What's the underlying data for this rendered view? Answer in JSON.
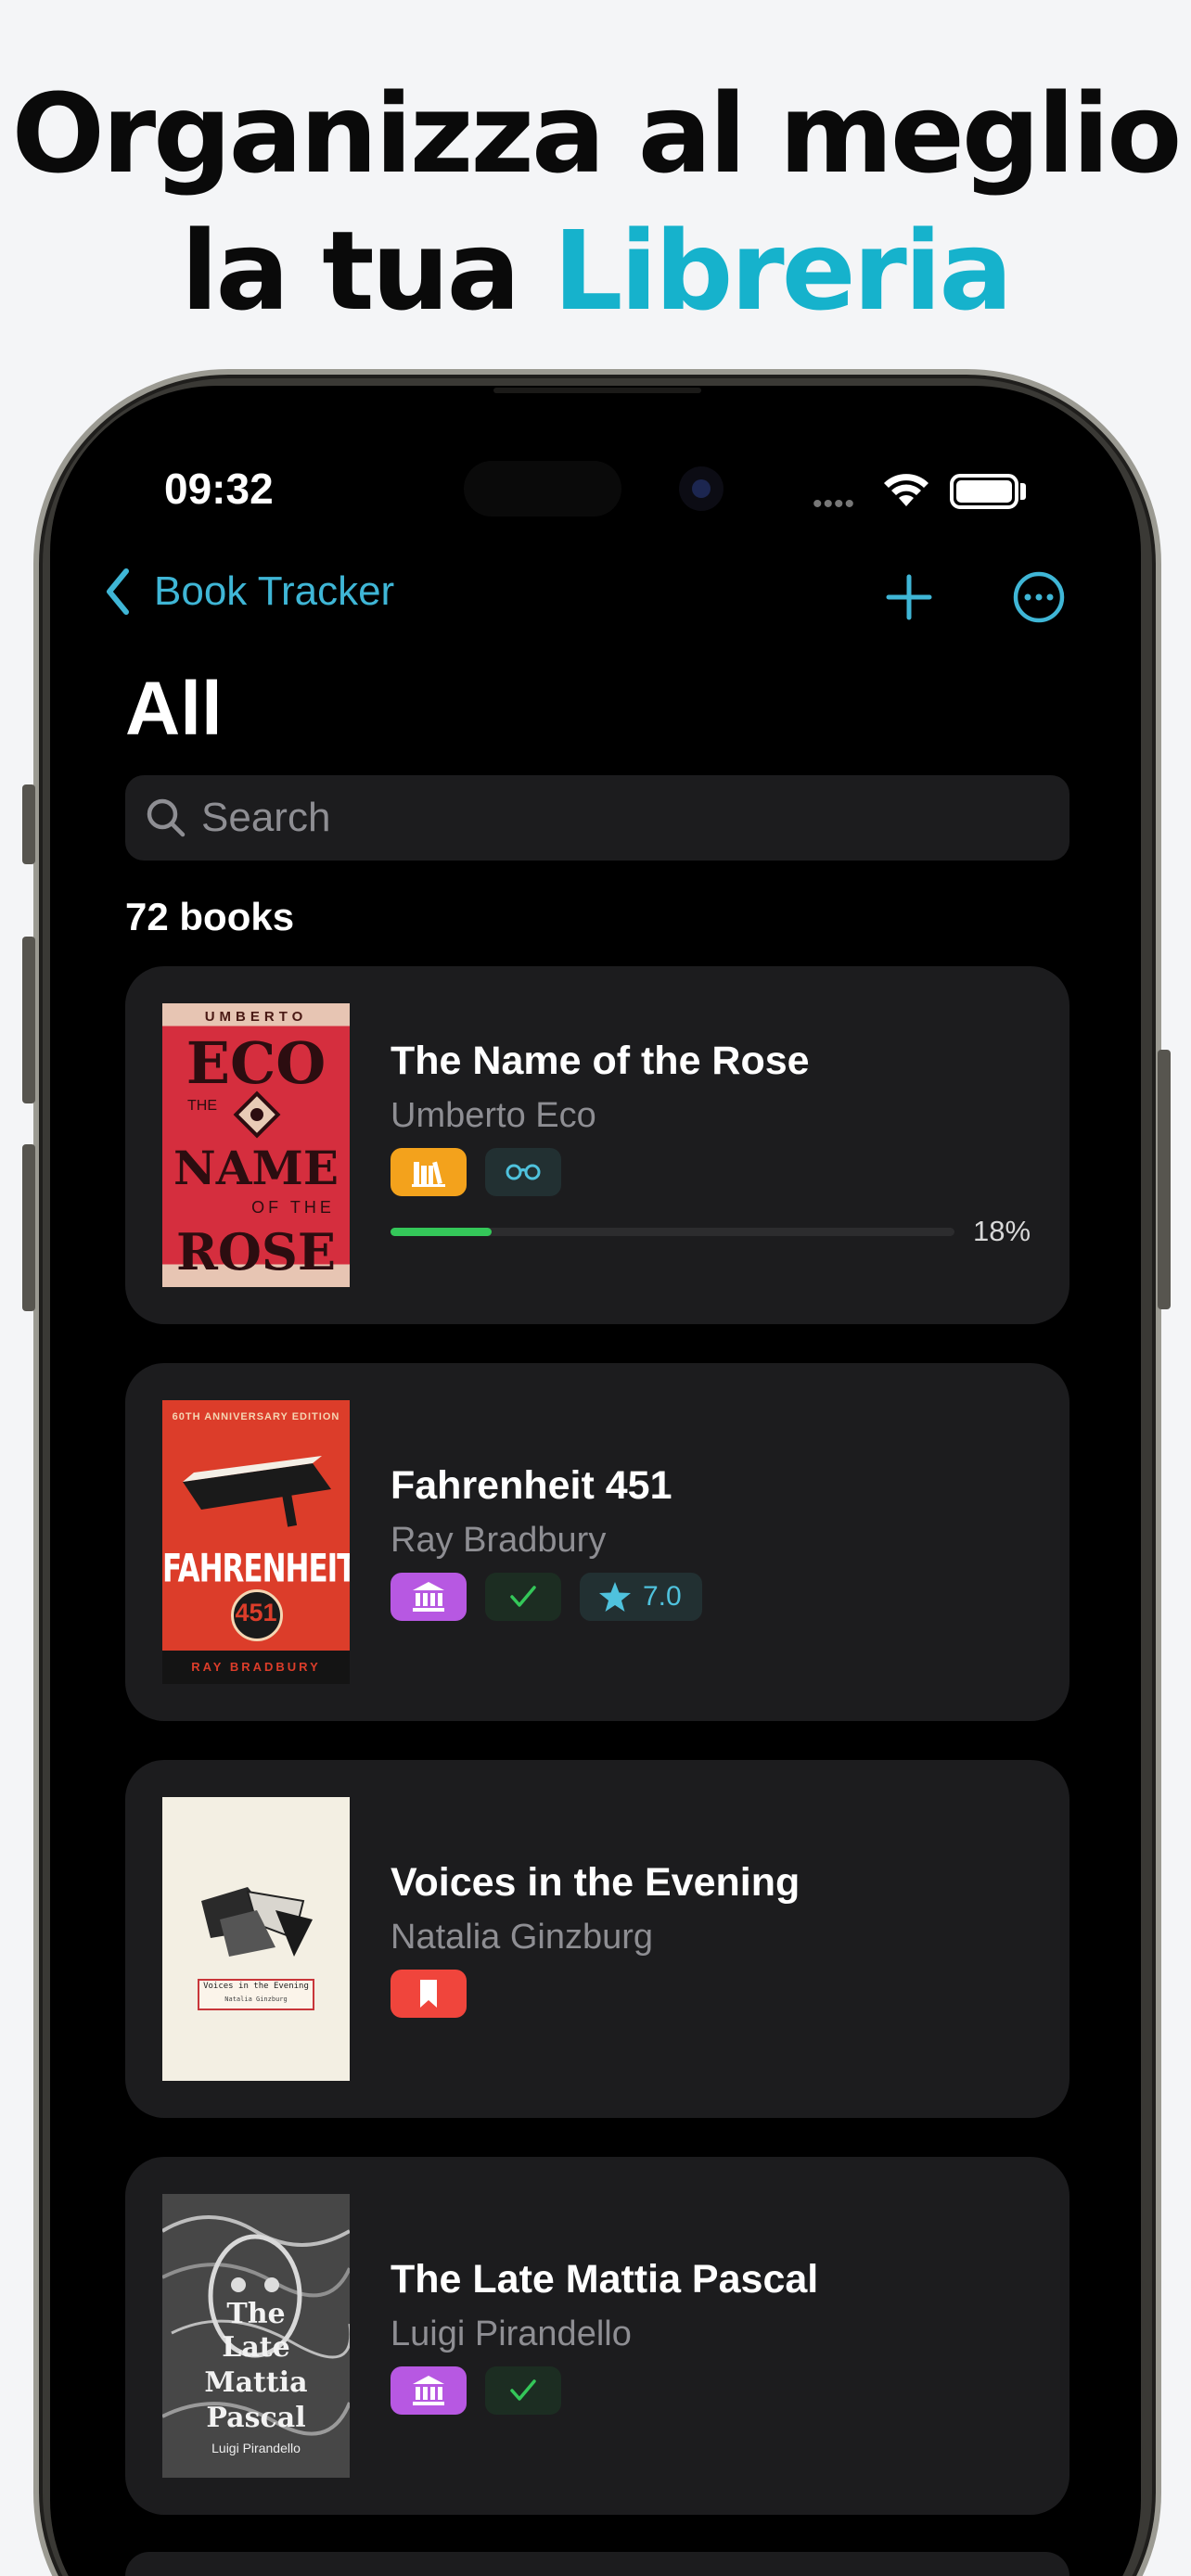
{
  "headline": {
    "line1": "Organizza al meglio",
    "line2_plain": "la tua",
    "line2_accent": "Libreria"
  },
  "colors": {
    "accent": "#16b2cc",
    "tint": "#3fb6d6",
    "progress": "#34c759",
    "shelf_orange": "#f3a21c",
    "shelf_purple": "#b758e2",
    "shelf_red": "#f0453c",
    "card": "#1c1c1e"
  },
  "status_bar": {
    "time": "09:32"
  },
  "nav": {
    "back_label": "Book Tracker",
    "back_icon": "chevron-left-icon",
    "add_icon": "plus-icon",
    "more_icon": "ellipsis-circle-icon"
  },
  "page": {
    "title": "All",
    "search_placeholder": "Search",
    "count_label": "72 books"
  },
  "books": [
    {
      "title": "The Name of the Rose",
      "author": "Umberto Eco",
      "badges": [
        "books-icon",
        "glasses-icon"
      ],
      "progress": 0.18,
      "progress_label": "18%",
      "cover": {
        "top": "UMBERTO",
        "word1": "ECO",
        "word2": "THE",
        "word3": "NAME",
        "word4": "OF THE",
        "word5": "ROSE"
      }
    },
    {
      "title": "Fahrenheit 451",
      "author": "Ray Bradbury",
      "badges": [
        "library-icon",
        "checkmark-icon",
        "star-icon"
      ],
      "rating": "7.0",
      "cover": {
        "top": "60TH ANNIVERSARY EDITION",
        "word1": "FAHRENHEIT",
        "word2": "451",
        "word3": "RAY BRADBURY"
      }
    },
    {
      "title": "Voices in the Evening",
      "author": "Natalia Ginzburg",
      "badges": [
        "bookmark-icon"
      ],
      "cover": {
        "word1": "Voices in the Evening",
        "word2": "Natalia Ginzburg"
      }
    },
    {
      "title": "The Late Mattia Pascal",
      "author": "Luigi Pirandello",
      "badges": [
        "library-icon",
        "checkmark-icon"
      ],
      "cover": {
        "word1": "The",
        "word2": "Late",
        "word3": "Mattia",
        "word4": "Pascal",
        "word5": "Luigi Pirandello"
      }
    }
  ]
}
